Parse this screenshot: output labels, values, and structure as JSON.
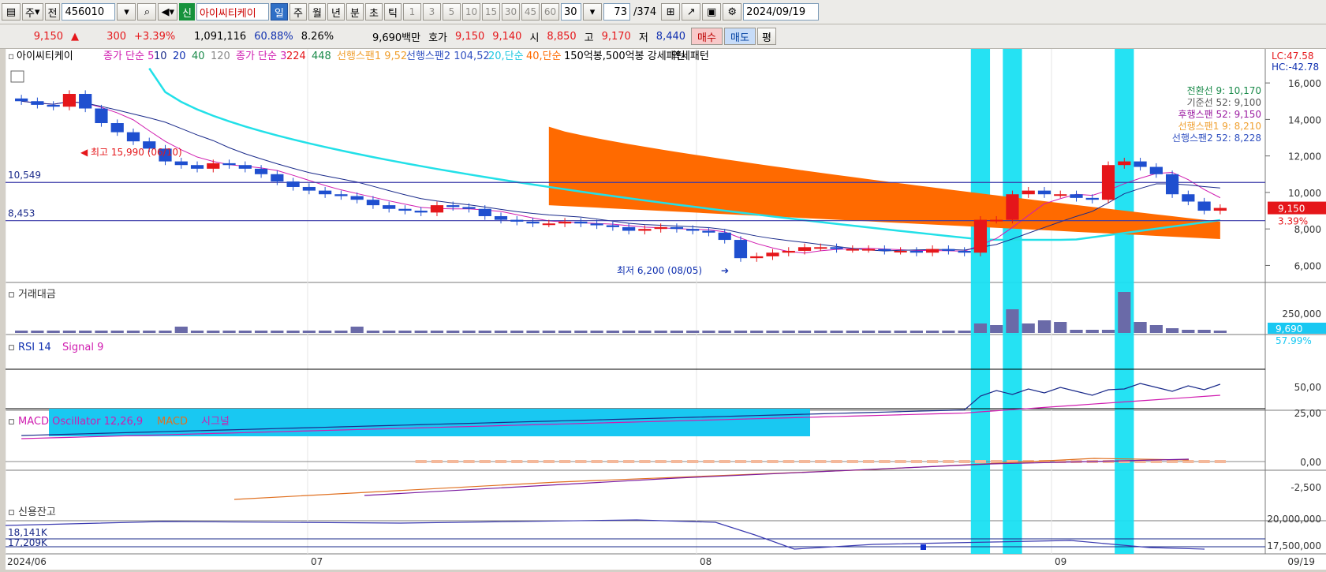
{
  "toolbar": {
    "market": "주",
    "period_unit": "전",
    "code": "456010",
    "new_badge": "신",
    "stock_name": "아이씨티케이",
    "periods": [
      "일",
      "주",
      "월",
      "년",
      "분",
      "초",
      "틱"
    ],
    "selected_period": "일",
    "minutes": [
      "1",
      "3",
      "5",
      "10",
      "15",
      "30",
      "45",
      "60"
    ],
    "count": "30",
    "page_current": "73",
    "page_total": "/374",
    "date": "2024/09/19"
  },
  "quote": {
    "price": "9,150",
    "arrow": "▲",
    "change": "300",
    "change_pct": "+3.39%",
    "volume": "1,091,116",
    "vol_ratio": "60.88%",
    "turnover": "8.26%",
    "amount": "9,690백만",
    "ask_label": "호가",
    "ask": "9,150",
    "bid": "9,140",
    "open_label": "시",
    "open": "8,850",
    "high_label": "고",
    "high": "9,170",
    "low_label": "저",
    "low": "8,440",
    "buy_label": "매수",
    "sell_label": "매도",
    "eval_label": "평"
  },
  "legend": {
    "name": "아이씨티케이",
    "ma_label": "종가 단순",
    "ma_periods": [
      "5",
      "10",
      "20",
      "40",
      "120"
    ],
    "ma2_label": "종가 단순",
    "ma2_periods": [
      "3",
      "224",
      "448"
    ],
    "span1": "선행스팬1 9,52",
    "span2": "선행스팬2 104,52",
    "ma20": "20,단순",
    "ma40": "40,단순",
    "pattern": "150억봉,500억봉 강세패턴",
    "weak": "약세패턴"
  },
  "price_panel": {
    "lc": "LC:47.58",
    "hc": "HC:-42.78",
    "hline1": "10,549",
    "hline2": "8,453",
    "max_label": "최고 15,990 (06/10)",
    "min_label": "최저 6,200 (08/05)",
    "ichimoku": [
      "전환선 9: 10,170",
      "기준선 52: 9,100",
      "후행스팬 52: 9,150",
      "선행스팬1 9: 8,210",
      "선행스팬2 52: 8,228"
    ],
    "price_tag": "9,150",
    "pct_tag": "3.39%",
    "y_ticks": [
      "16,000",
      "14,000",
      "12,000",
      "10,000",
      "8,000",
      "6,000"
    ]
  },
  "volume_panel": {
    "title": "거래대금",
    "y_ticks": [
      "250,000"
    ],
    "tag": "9,690",
    "tag_pct": "57.99%"
  },
  "rsi_panel": {
    "title": "RSI 14",
    "signal": "Signal 9",
    "y_ticks": [
      "50,00",
      "25,00"
    ]
  },
  "macd_panel": {
    "title": "MACD Oscillator 12,26,9",
    "macd": "MACD",
    "signal": "시그널",
    "y_ticks": [
      "0,00",
      "-2,500"
    ]
  },
  "credit_panel": {
    "title": "신용잔고",
    "v1": "18,141K",
    "v2": "17,209K",
    "y_ticks": [
      "20,000,000",
      "17,500,000"
    ]
  },
  "x_axis": {
    "labels": [
      "2024/06",
      "07",
      "08",
      "09"
    ],
    "end_label": "09/19"
  },
  "colors": {
    "up": "#e5161a",
    "down": "#1f4fcf",
    "highlight": "#19e0f2",
    "cloud": "#ff6a00"
  },
  "chart_data": {
    "type": "candlestick",
    "approx_closes": [
      15000,
      14800,
      14700,
      15400,
      14600,
      13800,
      13300,
      12800,
      12400,
      11700,
      11500,
      11300,
      11600,
      11500,
      11300,
      11000,
      10600,
      10300,
      10100,
      9900,
      9800,
      9600,
      9300,
      9100,
      9000,
      8900,
      9300,
      9200,
      9100,
      8700,
      8500,
      8400,
      8300,
      8300,
      8400,
      8300,
      8200,
      8100,
      7900,
      8000,
      8100,
      8000,
      7900,
      7800,
      7400,
      6400,
      6500,
      6700,
      6800,
      7000,
      7000,
      6900,
      6900,
      6900,
      6800,
      6800,
      6700,
      6900,
      6800,
      6700,
      8500,
      8500,
      9900,
      10100,
      9900,
      9900,
      9700,
      9600,
      11500,
      11700,
      11400,
      11000,
      9900,
      9500,
      9000,
      9150
    ],
    "ylim": [
      5500,
      17000
    ],
    "highlight_bars": [
      60,
      62,
      69
    ]
  }
}
